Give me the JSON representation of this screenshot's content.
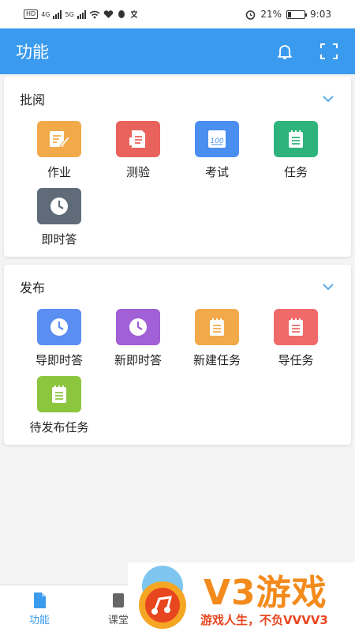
{
  "status_bar": {
    "left_chip": "HD",
    "net1": "4G",
    "net2": "5G",
    "battery": "21%",
    "time": "9:03"
  },
  "app_bar": {
    "title": "功能"
  },
  "sections": [
    {
      "title": "批阅",
      "items": [
        {
          "label": "作业",
          "color": "#f2a94a",
          "icon": "pencil-note-icon"
        },
        {
          "label": "测验",
          "color": "#e9625b",
          "icon": "document-icon"
        },
        {
          "label": "考试",
          "color": "#4a8ef0",
          "icon": "score-100-icon"
        },
        {
          "label": "任务",
          "color": "#2eb37c",
          "icon": "notepad-icon"
        },
        {
          "label": "即时答",
          "color": "#5f6b78",
          "icon": "clock-icon"
        }
      ]
    },
    {
      "title": "发布",
      "items": [
        {
          "label": "导即时答",
          "color": "#5b8ef1",
          "icon": "clock-icon"
        },
        {
          "label": "新即时答",
          "color": "#a160d6",
          "icon": "clock-icon"
        },
        {
          "label": "新建任务",
          "color": "#f2a94a",
          "icon": "notepad-icon"
        },
        {
          "label": "导任务",
          "color": "#f06a6a",
          "icon": "notepad-icon"
        },
        {
          "label": "待发布任务",
          "color": "#8cc63e",
          "icon": "notepad-icon"
        }
      ]
    }
  ],
  "bottom_nav": [
    {
      "label": "功能",
      "active": true
    },
    {
      "label": "课堂",
      "active": false
    }
  ],
  "watermark": {
    "brand": "V3游戏",
    "slogan": "游戏人生，不负VVVV3"
  },
  "colors": {
    "primary": "#3a9bee"
  }
}
